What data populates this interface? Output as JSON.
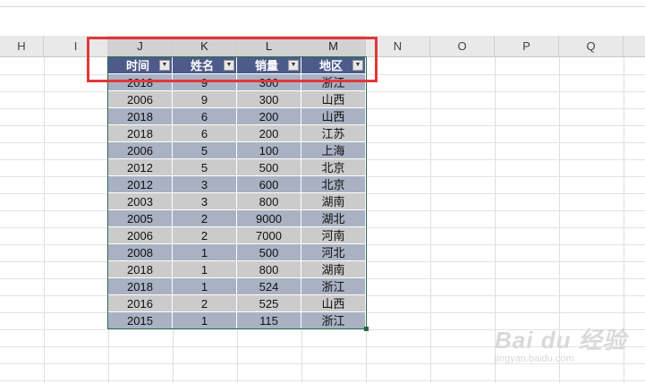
{
  "columns": [
    "H",
    "I",
    "J",
    "K",
    "L",
    "M",
    "N",
    "O",
    "P",
    "Q"
  ],
  "table": {
    "headers": [
      "时间",
      "姓名",
      "销量",
      "地区"
    ],
    "dropdown_glyph": "▼",
    "rows": [
      [
        "2018",
        "9",
        "300",
        "浙江"
      ],
      [
        "2006",
        "9",
        "300",
        "山西"
      ],
      [
        "2018",
        "6",
        "200",
        "山西"
      ],
      [
        "2018",
        "6",
        "200",
        "江苏"
      ],
      [
        "2006",
        "5",
        "100",
        "上海"
      ],
      [
        "2012",
        "5",
        "500",
        "北京"
      ],
      [
        "2012",
        "3",
        "600",
        "北京"
      ],
      [
        "2003",
        "3",
        "800",
        "湖南"
      ],
      [
        "2005",
        "2",
        "9000",
        "湖北"
      ],
      [
        "2006",
        "2",
        "7000",
        "河南"
      ],
      [
        "2008",
        "1",
        "500",
        "河北"
      ],
      [
        "2018",
        "1",
        "800",
        "湖南"
      ],
      [
        "2018",
        "1",
        "524",
        "浙江"
      ],
      [
        "2016",
        "2",
        "525",
        "山西"
      ],
      [
        "2015",
        "1",
        "115",
        "浙江"
      ]
    ]
  },
  "watermark": {
    "logo": "Bai du 经验",
    "url": "jingyan.baidu.com"
  },
  "colors": {
    "header_fill": "#4d5b8a",
    "band_dark": "#a9b1c3",
    "band_light": "#cbcbcb",
    "highlight": "#e0383a"
  }
}
